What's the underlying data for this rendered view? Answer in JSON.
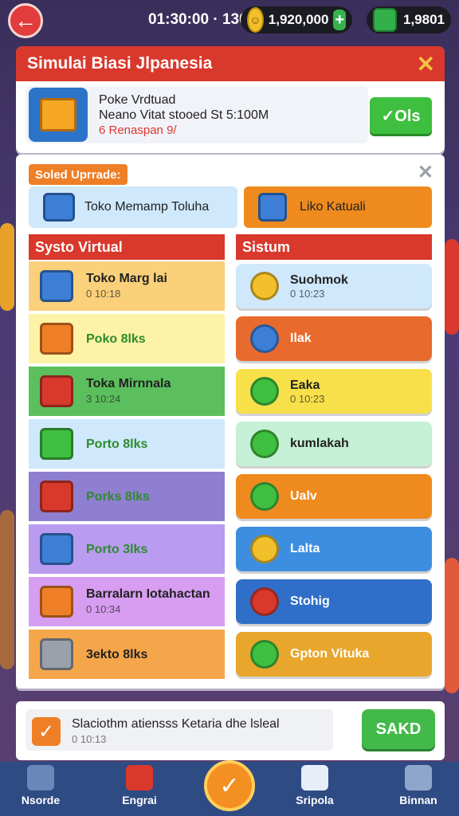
{
  "topbar": {
    "timer": "01:30:00 · 130",
    "coins": "1,920,000",
    "gems": "1,9801",
    "plus_label": "+",
    "back_icon": "back-arrow-icon",
    "coin_icon": "smiley-coin-icon",
    "gem_icon": "gem-icon"
  },
  "panel": {
    "title": "Simulai Biasi Jlpanesia",
    "offer_title": "Poke Vrdtuad",
    "offer_line": "Neano Vitat stooed St 5:100M",
    "offer_sub": "6 Renaspan 9/",
    "ok_label": "✓Ols"
  },
  "main": {
    "tag": "Soled Uprrade:",
    "wide_left": "Toko Memamp Toluha",
    "wide_right": "Liko Katuali",
    "col_left": "Systo Virtual",
    "col_right": "Sistum",
    "left_rows": [
      {
        "title": "Toko Marg lai",
        "sub": "0 10:18",
        "bg": "#fbd07a",
        "fg": "#222",
        "ico": "#3d7fd6"
      },
      {
        "title": "Poko 8lks",
        "sub": "",
        "bg": "#fdf3a6",
        "fg": "#2e8b2e",
        "ico": "#ef7f27"
      },
      {
        "title": "Toka Mirnnala",
        "sub": "3 10:24",
        "bg": "#5bbf5d",
        "fg": "#222",
        "ico": "#d9382c"
      },
      {
        "title": "Porto 8lks",
        "sub": "",
        "bg": "#cfe8fb",
        "fg": "#2e8b2e",
        "ico": "#3fbf3f"
      },
      {
        "title": "Porks 8lks",
        "sub": "",
        "bg": "#8f7fd0",
        "fg": "#2e8b2e",
        "ico": "#d9382c"
      },
      {
        "title": "Porto 3lks",
        "sub": "",
        "bg": "#b99bf0",
        "fg": "#2e8b2e",
        "ico": "#3d7fd6"
      },
      {
        "title": "Barralarn Iotahactan",
        "sub": "0 10:34",
        "bg": "#d79df0",
        "fg": "#222",
        "ico": "#ef7f27"
      },
      {
        "title": "3ekto 8lks",
        "sub": "",
        "bg": "#f5a64a",
        "fg": "#222",
        "ico": "#9aa0aa"
      }
    ],
    "right_rows": [
      {
        "title": "Suohmok",
        "sub": "0 10:23",
        "bg": "#cfe8fb",
        "fg": "#222",
        "ico": "#f2c02a"
      },
      {
        "title": "Ilak",
        "sub": "",
        "bg": "#e86a2c",
        "fg": "#fff",
        "ico": "#3d7fd6"
      },
      {
        "title": "Eaka",
        "sub": "0 10:23",
        "bg": "#f7e04a",
        "fg": "#222",
        "ico": "#3fbf3f"
      },
      {
        "title": "kumlakah",
        "sub": "",
        "bg": "#c6f0d6",
        "fg": "#222",
        "ico": "#3fbf3f"
      },
      {
        "title": "Ualv",
        "sub": "",
        "bg": "#ef8a1f",
        "fg": "#fff",
        "ico": "#3fbf3f"
      },
      {
        "title": "Lalta",
        "sub": "",
        "bg": "#3d8ee0",
        "fg": "#fff",
        "ico": "#f2c02a"
      },
      {
        "title": "Stohig",
        "sub": "",
        "bg": "#2f6fc9",
        "fg": "#fff",
        "ico": "#d9382c"
      },
      {
        "title": "Gpton Vituka",
        "sub": "",
        "bg": "#e8a62c",
        "fg": "#fff",
        "ico": "#3fbf3f"
      }
    ]
  },
  "footer": {
    "title": "Slaciothm atiensss Ketaria dhe lsleal",
    "sub": "0 10:13",
    "save_label": "SAKD",
    "check": "✓"
  },
  "nav": {
    "items": [
      "Nsorde",
      "Engrai",
      "Sripola",
      "Binnan"
    ],
    "center": "✓"
  }
}
